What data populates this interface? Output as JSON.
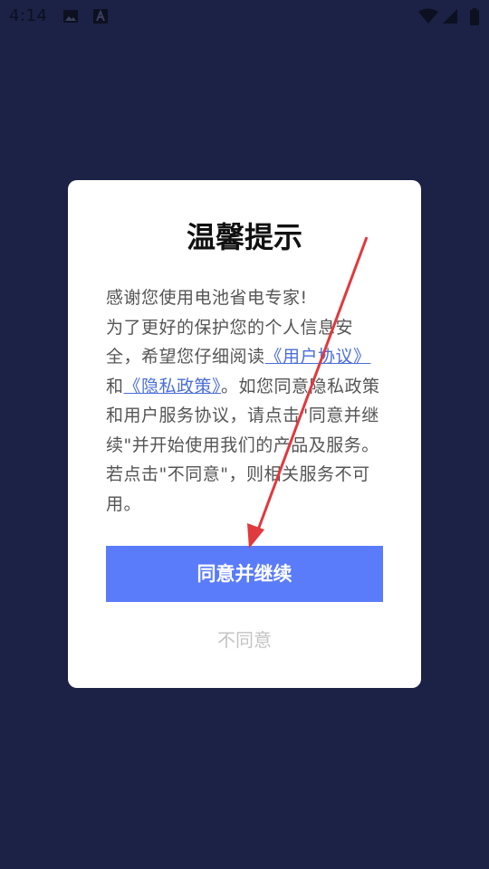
{
  "status_bar": {
    "time": "4:14",
    "left_icons": [
      "image-icon",
      "text-a-icon"
    ],
    "right_icons": [
      "wifi-icon",
      "signal-icon",
      "battery-icon"
    ]
  },
  "colors": {
    "background": "#1c2146",
    "dialog": "#ffffff",
    "primary_button": "#5a7cfa",
    "link": "#4b6ed8",
    "annotation_arrow": "#e0393e"
  },
  "dialog": {
    "title": "温馨提示",
    "line1": "感谢您使用电池省电专家!",
    "para_part1": "为了更好的保护您的个人信息安全，希望您仔细阅读",
    "link_user_agreement": "《用户协议》",
    "para_and": "和",
    "link_privacy_policy": "《隐私政策》",
    "para_part2": "。如您同意隐私政策和用户服务协议，请点击\"同意并继续\"并开始使用我们的产品及服务。若点击\"不同意\"，则相关服务不可用。",
    "agree_button": "同意并继续",
    "disagree_button": "不同意"
  }
}
